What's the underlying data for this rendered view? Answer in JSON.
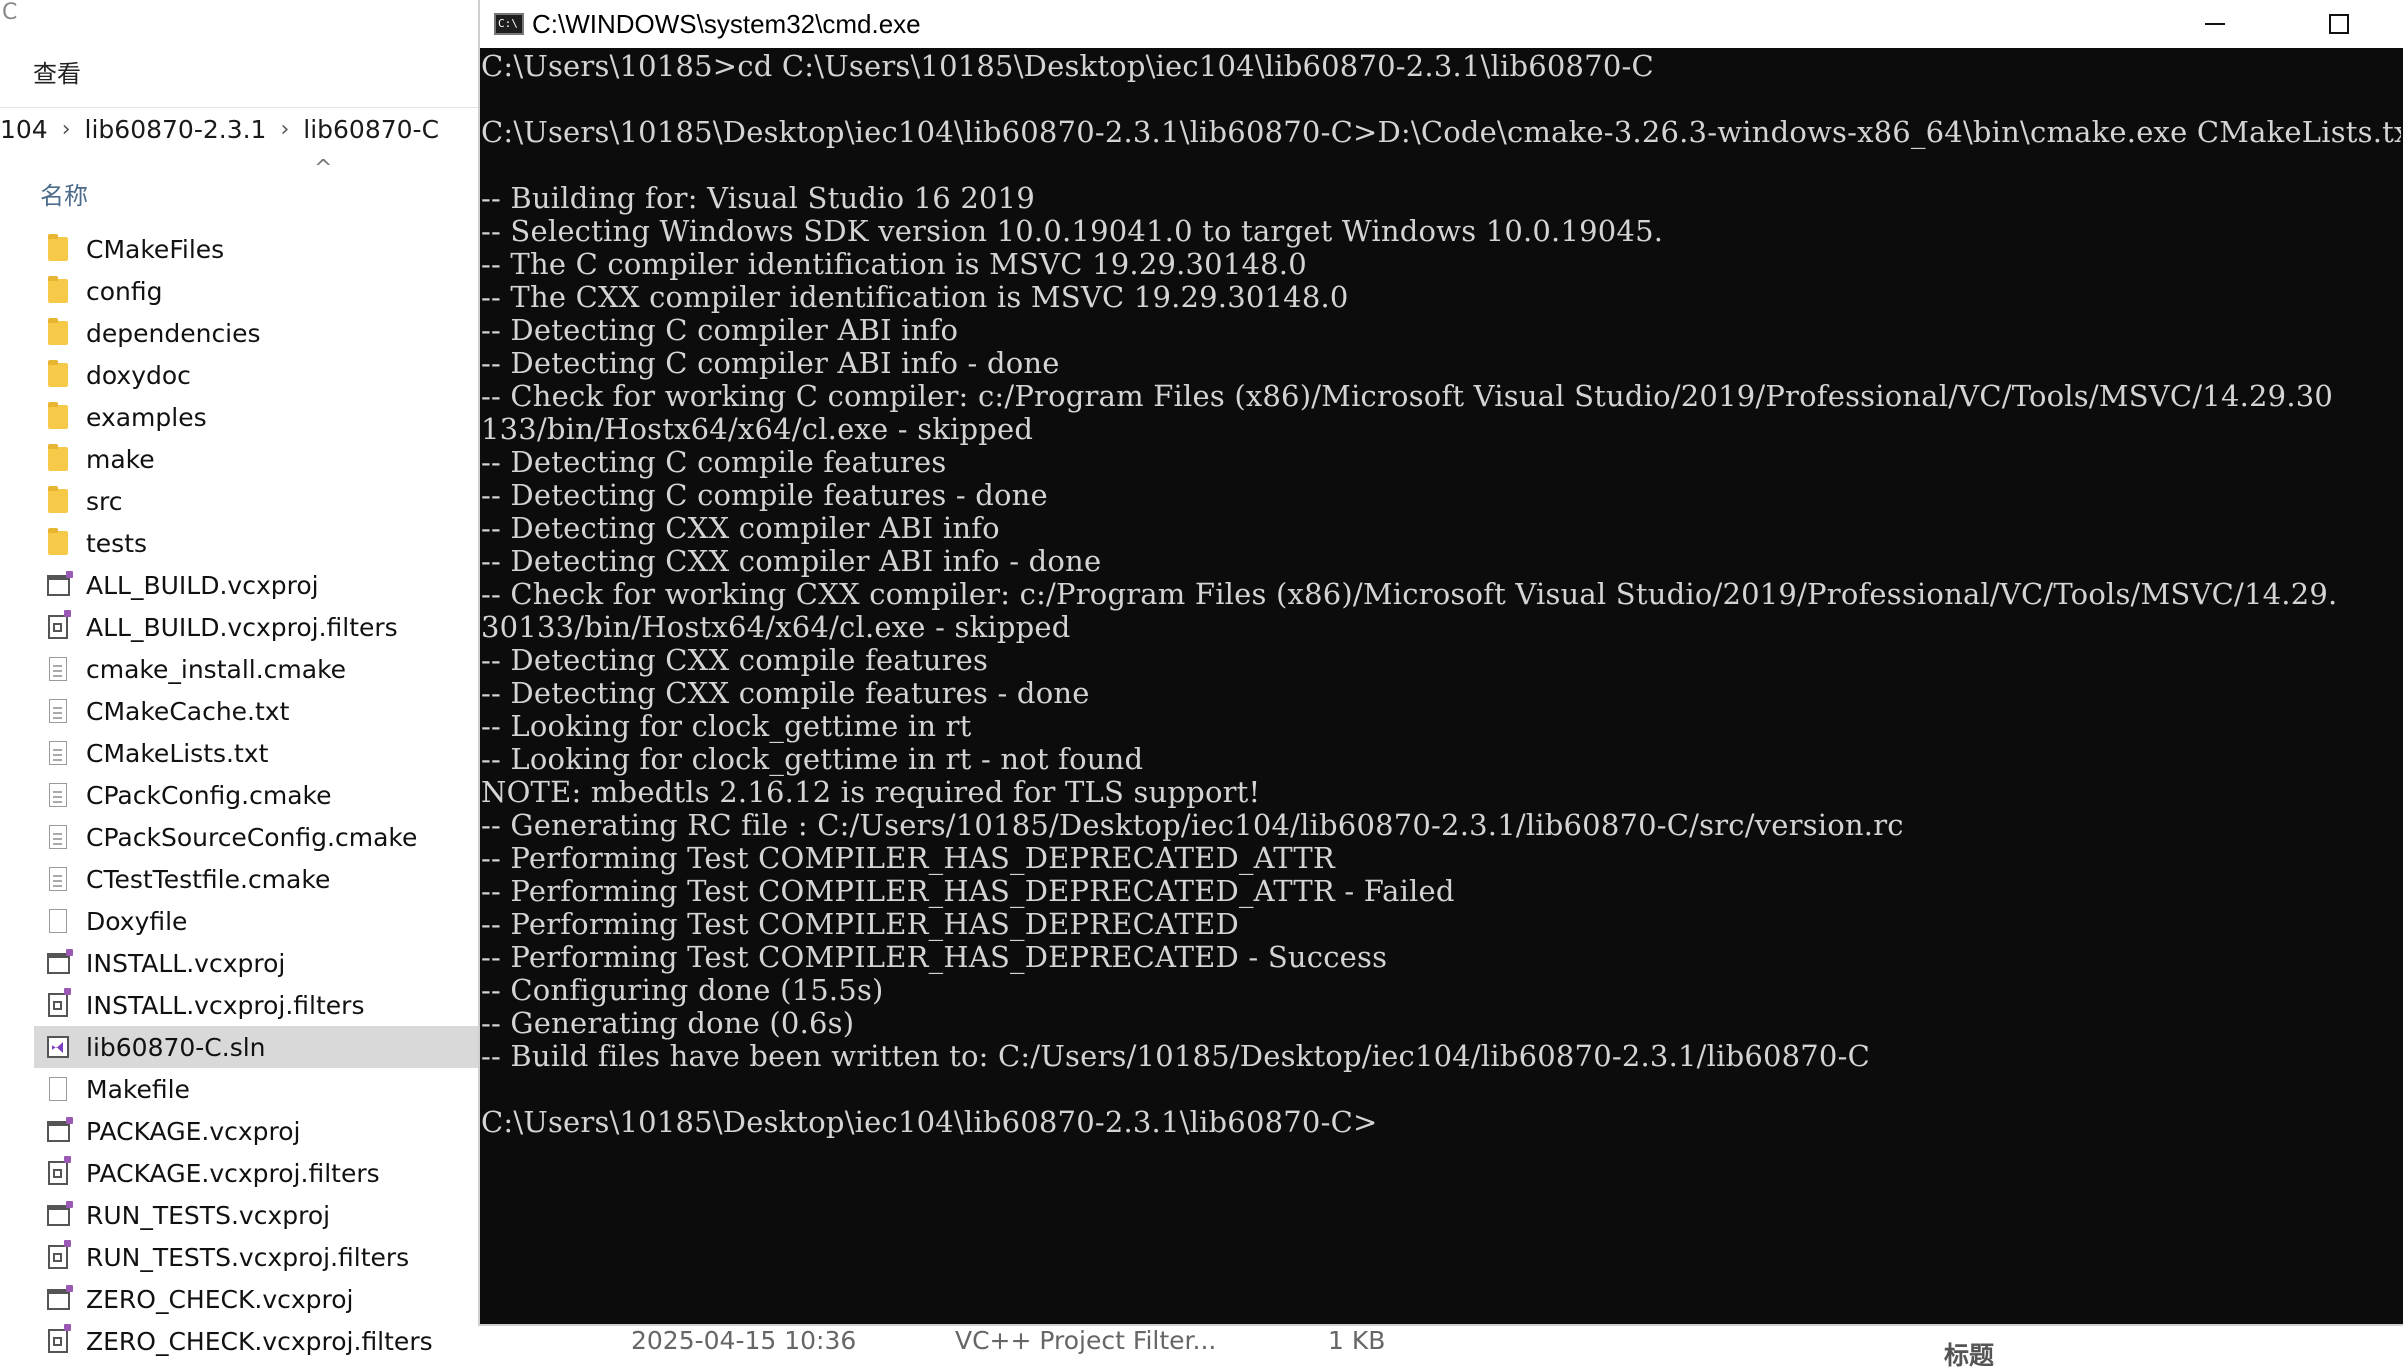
{
  "explorer": {
    "search_fragment": "C",
    "menu_view": "查看",
    "breadcrumb": [
      "104",
      "lib60870-2.3.1",
      "lib60870-C"
    ],
    "column_name": "名称",
    "sort_indicator": "^",
    "files": [
      {
        "name": "CMakeFiles",
        "icon": "folder-icon"
      },
      {
        "name": "config",
        "icon": "folder-icon"
      },
      {
        "name": "dependencies",
        "icon": "folder-icon"
      },
      {
        "name": "doxydoc",
        "icon": "folder-icon"
      },
      {
        "name": "examples",
        "icon": "folder-icon"
      },
      {
        "name": "make",
        "icon": "folder-icon"
      },
      {
        "name": "src",
        "icon": "folder-icon"
      },
      {
        "name": "tests",
        "icon": "folder-icon"
      },
      {
        "name": "ALL_BUILD.vcxproj",
        "icon": "vcxproj-icon"
      },
      {
        "name": "ALL_BUILD.vcxproj.filters",
        "icon": "filters-icon"
      },
      {
        "name": "cmake_install.cmake",
        "icon": "document-icon"
      },
      {
        "name": "CMakeCache.txt",
        "icon": "document-icon"
      },
      {
        "name": "CMakeLists.txt",
        "icon": "document-icon"
      },
      {
        "name": "CPackConfig.cmake",
        "icon": "document-icon"
      },
      {
        "name": "CPackSourceConfig.cmake",
        "icon": "document-icon"
      },
      {
        "name": "CTestTestfile.cmake",
        "icon": "document-icon"
      },
      {
        "name": "Doxyfile",
        "icon": "blank-file-icon"
      },
      {
        "name": "INSTALL.vcxproj",
        "icon": "vcxproj-icon"
      },
      {
        "name": "INSTALL.vcxproj.filters",
        "icon": "filters-icon"
      },
      {
        "name": "lib60870-C.sln",
        "icon": "solution-icon",
        "selected": true
      },
      {
        "name": "Makefile",
        "icon": "blank-file-icon"
      },
      {
        "name": "PACKAGE.vcxproj",
        "icon": "vcxproj-icon"
      },
      {
        "name": "PACKAGE.vcxproj.filters",
        "icon": "filters-icon"
      },
      {
        "name": "RUN_TESTS.vcxproj",
        "icon": "vcxproj-icon"
      },
      {
        "name": "RUN_TESTS.vcxproj.filters",
        "icon": "filters-icon"
      },
      {
        "name": "ZERO_CHECK.vcxproj",
        "icon": "vcxproj-icon"
      },
      {
        "name": "ZERO_CHECK.vcxproj.filters",
        "icon": "filters-icon"
      }
    ],
    "status_row": {
      "date": "2025-04-15 10:36",
      "type": "VC++ Project Filter...",
      "size": "1 KB",
      "extra": "标题"
    }
  },
  "cmd": {
    "title": "C:\\WINDOWS\\system32\\cmd.exe",
    "icon": "cmd-icon",
    "lines": [
      "C:\\Users\\10185>cd C:\\Users\\10185\\Desktop\\iec104\\lib60870-2.3.1\\lib60870-C",
      "",
      "C:\\Users\\10185\\Desktop\\iec104\\lib60870-2.3.1\\lib60870-C>D:\\Code\\cmake-3.26.3-windows-x86_64\\bin\\cmake.exe CMakeLists.txt",
      "",
      "-- Building for: Visual Studio 16 2019",
      "-- Selecting Windows SDK version 10.0.19041.0 to target Windows 10.0.19045.",
      "-- The C compiler identification is MSVC 19.29.30148.0",
      "-- The CXX compiler identification is MSVC 19.29.30148.0",
      "-- Detecting C compiler ABI info",
      "-- Detecting C compiler ABI info - done",
      "-- Check for working C compiler: c:/Program Files (x86)/Microsoft Visual Studio/2019/Professional/VC/Tools/MSVC/14.29.30",
      "133/bin/Hostx64/x64/cl.exe - skipped",
      "-- Detecting C compile features",
      "-- Detecting C compile features - done",
      "-- Detecting CXX compiler ABI info",
      "-- Detecting CXX compiler ABI info - done",
      "-- Check for working CXX compiler: c:/Program Files (x86)/Microsoft Visual Studio/2019/Professional/VC/Tools/MSVC/14.29.",
      "30133/bin/Hostx64/x64/cl.exe - skipped",
      "-- Detecting CXX compile features",
      "-- Detecting CXX compile features - done",
      "-- Looking for clock_gettime in rt",
      "-- Looking for clock_gettime in rt - not found",
      "NOTE: mbedtls 2.16.12 is required for TLS support!",
      "-- Generating RC file : C:/Users/10185/Desktop/iec104/lib60870-2.3.1/lib60870-C/src/version.rc",
      "-- Performing Test COMPILER_HAS_DEPRECATED_ATTR",
      "-- Performing Test COMPILER_HAS_DEPRECATED_ATTR - Failed",
      "-- Performing Test COMPILER_HAS_DEPRECATED",
      "-- Performing Test COMPILER_HAS_DEPRECATED - Success",
      "-- Configuring done (15.5s)",
      "-- Generating done (0.6s)",
      "-- Build files have been written to: C:/Users/10185/Desktop/iec104/lib60870-2.3.1/lib60870-C",
      "",
      "C:\\Users\\10185\\Desktop\\iec104\\lib60870-2.3.1\\lib60870-C>"
    ],
    "controls": {
      "minimize": "minimize-icon",
      "maximize": "maximize-icon",
      "close": "close-icon"
    },
    "colors": {
      "background": "#0c0c0c",
      "text": "#d4d4d4",
      "titlebar": "#ffffff"
    }
  }
}
